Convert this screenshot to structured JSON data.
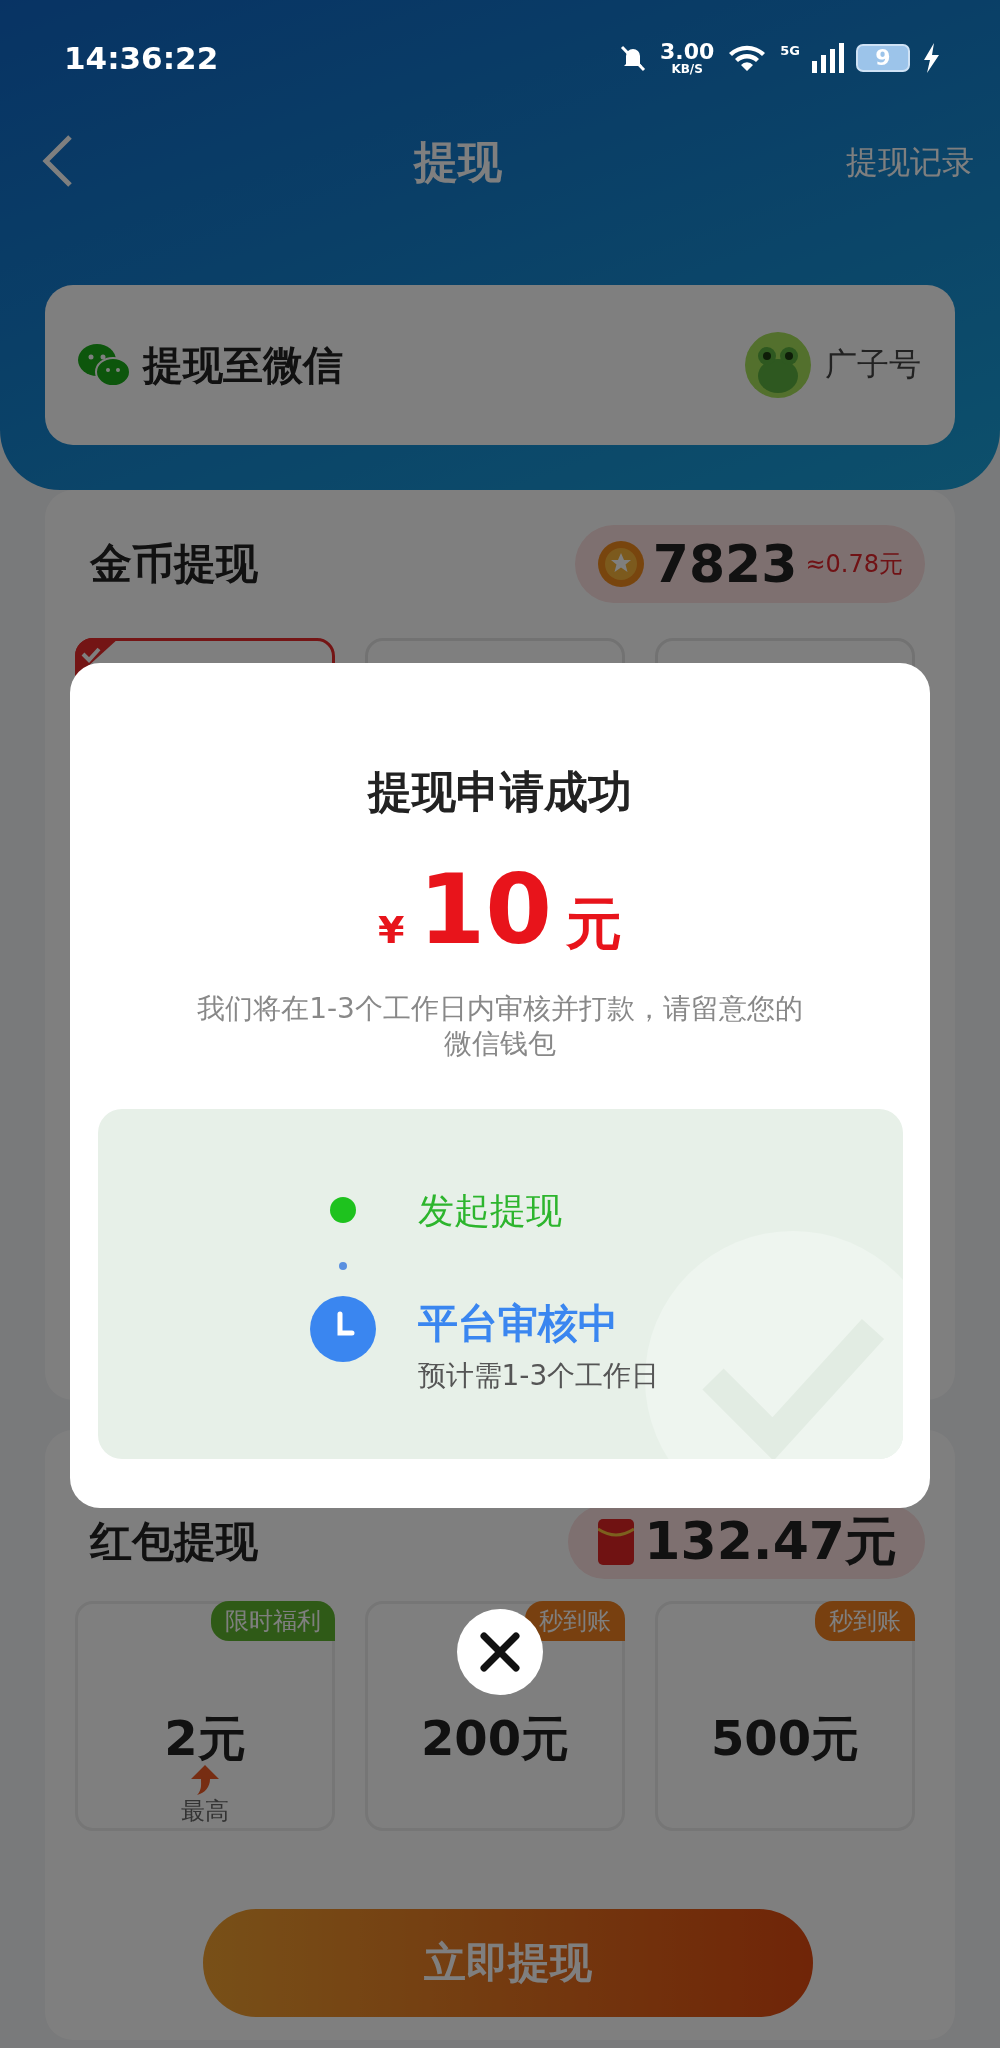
{
  "status_bar": {
    "time": "14:36:22",
    "net_speed": "3.00",
    "net_speed_unit": "KB/S",
    "network": "5G",
    "battery": "9",
    "charging": true
  },
  "nav": {
    "title": "提现",
    "action": "提现记录"
  },
  "account": {
    "label": "提现至微信",
    "name": "广子号"
  },
  "coin_section": {
    "title": "金币提现",
    "balance": "7823",
    "approx": "≈0.78元",
    "options": [
      {
        "selected": true
      },
      {
        "selected": false
      },
      {
        "selected": false
      }
    ]
  },
  "red_section": {
    "title": "红包提现",
    "balance": "132.47元",
    "options": [
      {
        "tag": "限时福利",
        "kind": "promo",
        "amount": "2元",
        "note": "最高"
      },
      {
        "tag": "秒到账",
        "kind": "instant",
        "amount": "200元"
      },
      {
        "tag": "秒到账",
        "kind": "instant",
        "amount": "500元"
      }
    ]
  },
  "submit_button": "立即提现",
  "dialog": {
    "title": "提现申请成功",
    "currency": "¥",
    "amount": "10",
    "unit": "元",
    "message": "我们将在1-3个工作日内审核并打款，请留意您的微信钱包",
    "steps": [
      {
        "kind": "done",
        "label": "发起提现"
      },
      {
        "kind": "pending",
        "label": "平台审核中",
        "note": "预计需1-3个工作日"
      }
    ]
  }
}
